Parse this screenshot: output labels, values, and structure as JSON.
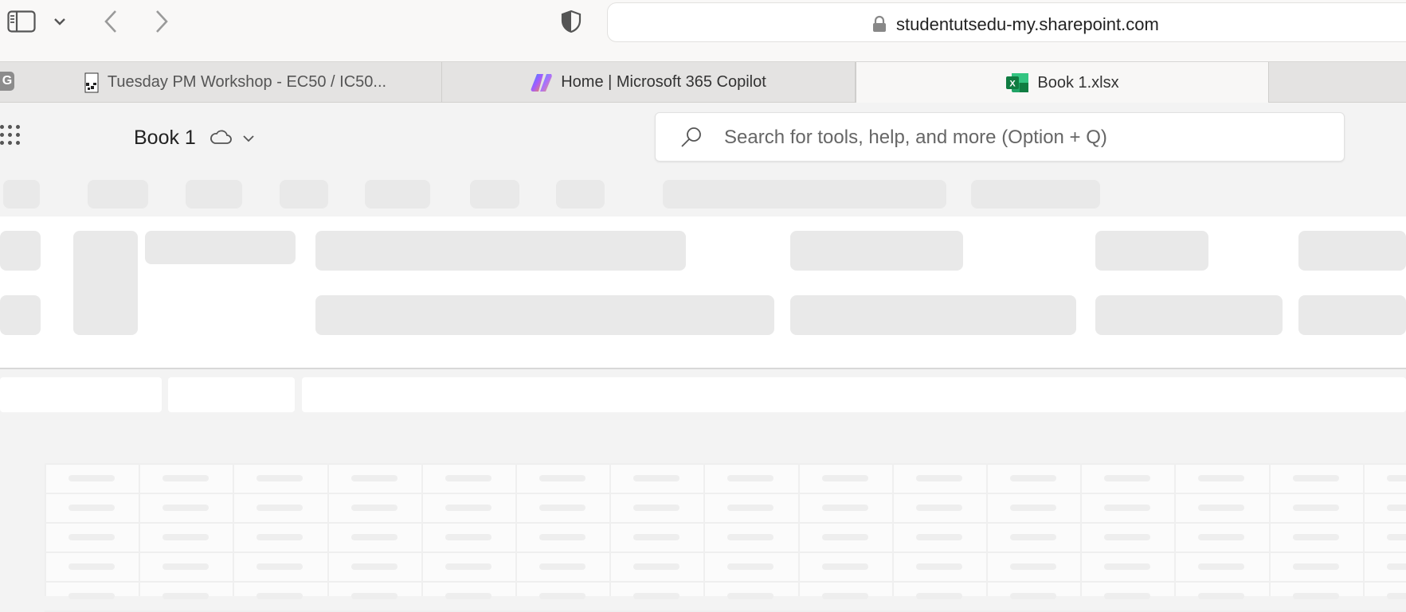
{
  "browser": {
    "url": "studentutsedu-my.sharepoint.com",
    "icons": [
      "sidebar-icon",
      "chevron-down-icon",
      "back-arrow-icon",
      "forward-arrow-icon",
      "shield-icon",
      "lock-icon"
    ]
  },
  "tabs": [
    {
      "label": "Tuesday PM Workshop - EC50 / IC50...",
      "icon": "favicon-icon",
      "active": false
    },
    {
      "label": "Home | Microsoft 365 Copilot",
      "icon": "copilot-icon",
      "active": false
    },
    {
      "label": "Book 1.xlsx",
      "icon": "excel-icon",
      "active": true
    }
  ],
  "pinned_tab": {
    "label": "G"
  },
  "app": {
    "doc_title": "Book 1",
    "search_placeholder": "Search for tools, help, and more (Option + Q)",
    "icons": [
      "app-launcher-icon",
      "cloud-icon",
      "chevron-down-icon",
      "search-icon"
    ]
  },
  "colors": {
    "excel_green": "#107c41",
    "copilot_accent": "#7a5cff",
    "skeleton": "#e9e9e9"
  }
}
